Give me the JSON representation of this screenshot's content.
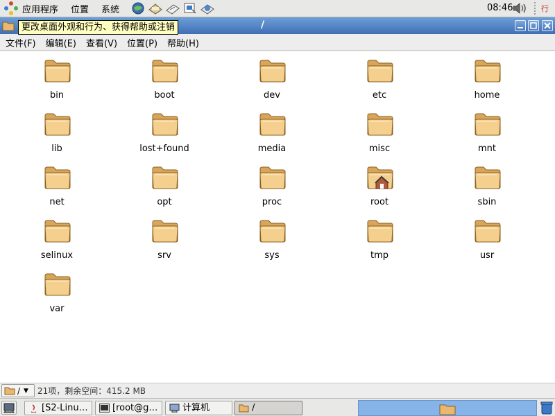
{
  "top_panel": {
    "menus": [
      "应用程序",
      "位置",
      "系统"
    ],
    "launchers": [
      "browser-icon",
      "mail-icon",
      "writer-icon",
      "impress-icon",
      "calc-icon"
    ],
    "clock": "08:46",
    "input_method": "行"
  },
  "window": {
    "title": "/",
    "tooltip": "更改桌面外观和行为、获得帮助或注销",
    "menubar": [
      "文件(F)",
      "编辑(E)",
      "查看(V)",
      "位置(P)",
      "帮助(H)"
    ]
  },
  "files": [
    {
      "name": "bin",
      "icon": "folder-icon"
    },
    {
      "name": "boot",
      "icon": "folder-icon"
    },
    {
      "name": "dev",
      "icon": "folder-icon"
    },
    {
      "name": "etc",
      "icon": "folder-icon"
    },
    {
      "name": "home",
      "icon": "folder-icon"
    },
    {
      "name": "lib",
      "icon": "folder-icon"
    },
    {
      "name": "lost+found",
      "icon": "folder-icon"
    },
    {
      "name": "media",
      "icon": "folder-icon"
    },
    {
      "name": "misc",
      "icon": "folder-icon"
    },
    {
      "name": "mnt",
      "icon": "folder-icon"
    },
    {
      "name": "net",
      "icon": "folder-icon"
    },
    {
      "name": "opt",
      "icon": "folder-icon"
    },
    {
      "name": "proc",
      "icon": "folder-icon"
    },
    {
      "name": "root",
      "icon": "home-folder-icon"
    },
    {
      "name": "sbin",
      "icon": "folder-icon"
    },
    {
      "name": "selinux",
      "icon": "folder-icon"
    },
    {
      "name": "srv",
      "icon": "folder-icon"
    },
    {
      "name": "sys",
      "icon": "folder-icon"
    },
    {
      "name": "tmp",
      "icon": "folder-icon"
    },
    {
      "name": "usr",
      "icon": "folder-icon"
    },
    {
      "name": "var",
      "icon": "folder-icon"
    }
  ],
  "statusbar": {
    "location": "/",
    "info": "21项，剩余空间：415.2 MB"
  },
  "taskbar": {
    "tasks": [
      {
        "label": "[S2-Linu…",
        "icon": "java-icon"
      },
      {
        "label": "[root@g…",
        "icon": "terminal-icon"
      },
      {
        "label": "计算机",
        "icon": "computer-icon"
      },
      {
        "label": "/",
        "icon": "folder-icon",
        "active": true
      }
    ]
  },
  "colors": {
    "titlebar": "#3f6fb5",
    "folder": "#e8b870",
    "tooltip_bg": "#ffffc0",
    "workspace": "#86b4e8"
  }
}
